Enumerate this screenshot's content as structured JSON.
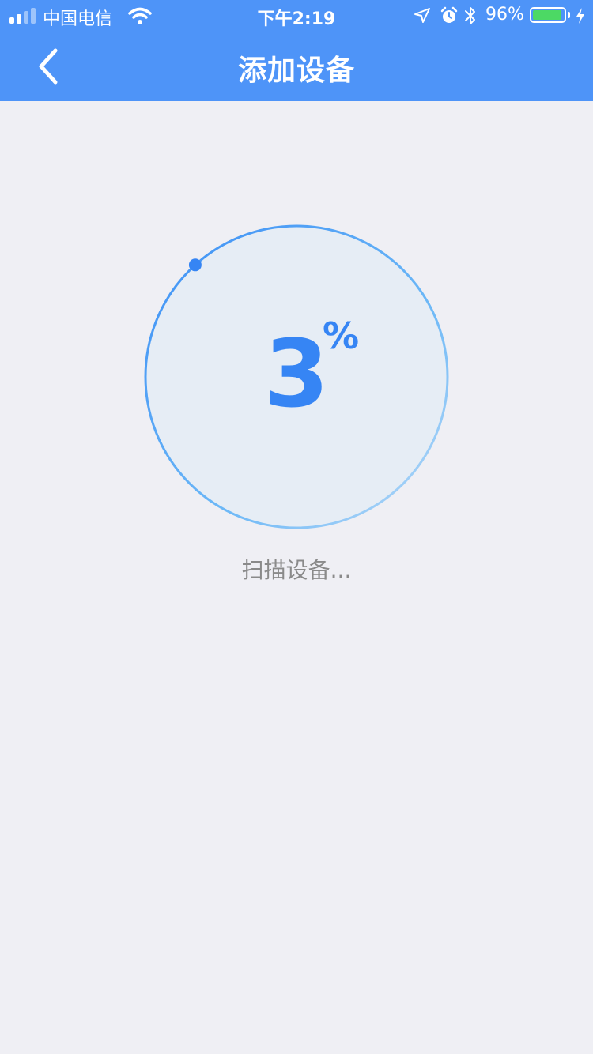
{
  "status_bar": {
    "carrier": "中国电信",
    "time": "下午2:19",
    "battery_percent": "96%",
    "battery_level": 0.96,
    "icons": [
      "signal-icon",
      "wifi-icon",
      "location-icon",
      "alarm-icon",
      "bluetooth-icon",
      "battery-icon",
      "charging-icon"
    ]
  },
  "nav": {
    "title": "添加设备",
    "back_icon": "chevron-left-icon"
  },
  "progress": {
    "value": "3",
    "unit": "%",
    "fraction": 0.03,
    "status_text": "扫描设备..."
  },
  "colors": {
    "header_bg": "#4e94f8",
    "accent": "#3685f4",
    "page_bg": "#efeff4",
    "ring_fill": "#e6edf5",
    "battery_green": "#4cd964"
  }
}
